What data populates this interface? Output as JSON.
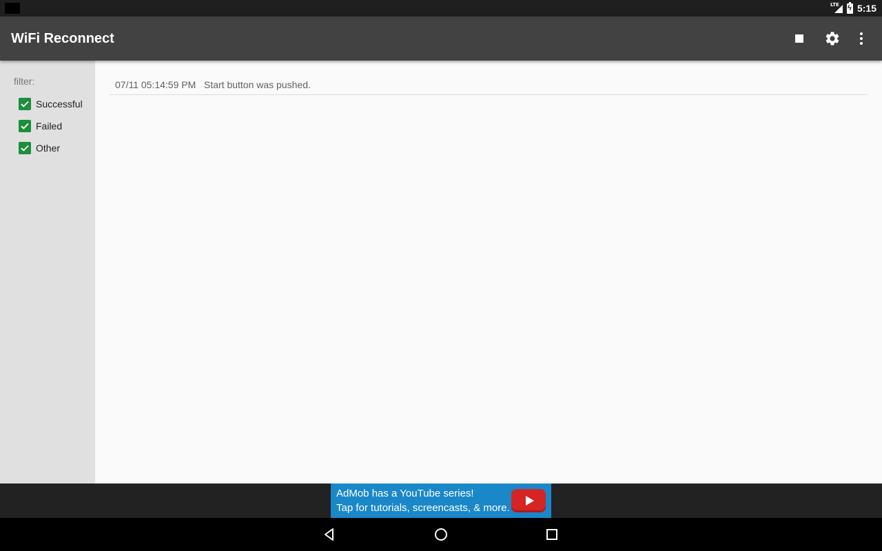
{
  "status_bar": {
    "network_label": "LTE",
    "clock": "5:15"
  },
  "app_bar": {
    "title": "WiFi Reconnect",
    "actions": [
      {
        "name": "stop-icon"
      },
      {
        "name": "gear-icon"
      },
      {
        "name": "more-vert-icon"
      }
    ]
  },
  "sidebar": {
    "filter_label": "filter:",
    "filters": [
      {
        "label": "Successful",
        "checked": true
      },
      {
        "label": "Failed",
        "checked": true
      },
      {
        "label": "Other",
        "checked": true
      }
    ]
  },
  "log": {
    "entries": [
      {
        "timestamp": "07/11 05:14:59 PM",
        "message": "Start button was pushed."
      }
    ]
  },
  "ad": {
    "line1": "AdMob has a YouTube series!",
    "line2": "Tap for tutorials, screencasts, & more.",
    "icon": "youtube-play-icon"
  },
  "nav_bar": {
    "buttons": [
      "back-icon",
      "home-icon",
      "recents-icon"
    ]
  },
  "colors": {
    "app_bar": "#424242",
    "checkbox": "#1b8f3a",
    "ad_banner": "#1a87c9",
    "youtube_red": "#d42424"
  }
}
